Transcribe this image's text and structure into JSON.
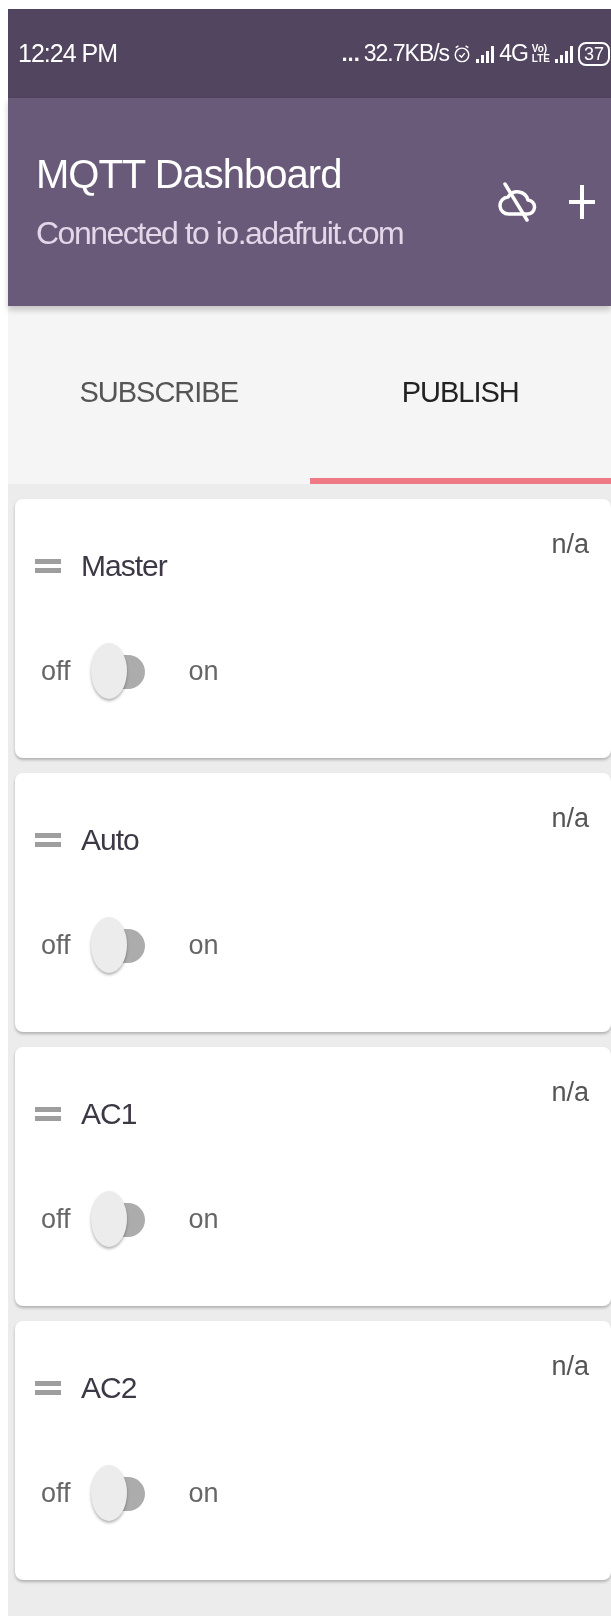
{
  "status_bar": {
    "time": "12:24 PM",
    "more": "...",
    "speed": "32.7KB/s",
    "network": "4G",
    "volte_top": "Vo)",
    "volte_bottom": "LTE",
    "battery": "37"
  },
  "app_bar": {
    "title": "MQTT Dashboard",
    "subtitle": "Connected to io.adafruit.com"
  },
  "tabs": [
    {
      "label": "SUBSCRIBE",
      "selected": false
    },
    {
      "label": "PUBLISH",
      "selected": true
    }
  ],
  "cards": [
    {
      "name": "Master",
      "value": "n/a",
      "off_label": "off",
      "on_label": "on",
      "on": false
    },
    {
      "name": "Auto",
      "value": "n/a",
      "off_label": "off",
      "on_label": "on",
      "on": false
    },
    {
      "name": "AC1",
      "value": "n/a",
      "off_label": "off",
      "on_label": "on",
      "on": false
    },
    {
      "name": "AC2",
      "value": "n/a",
      "off_label": "off",
      "on_label": "on",
      "on": false
    }
  ]
}
